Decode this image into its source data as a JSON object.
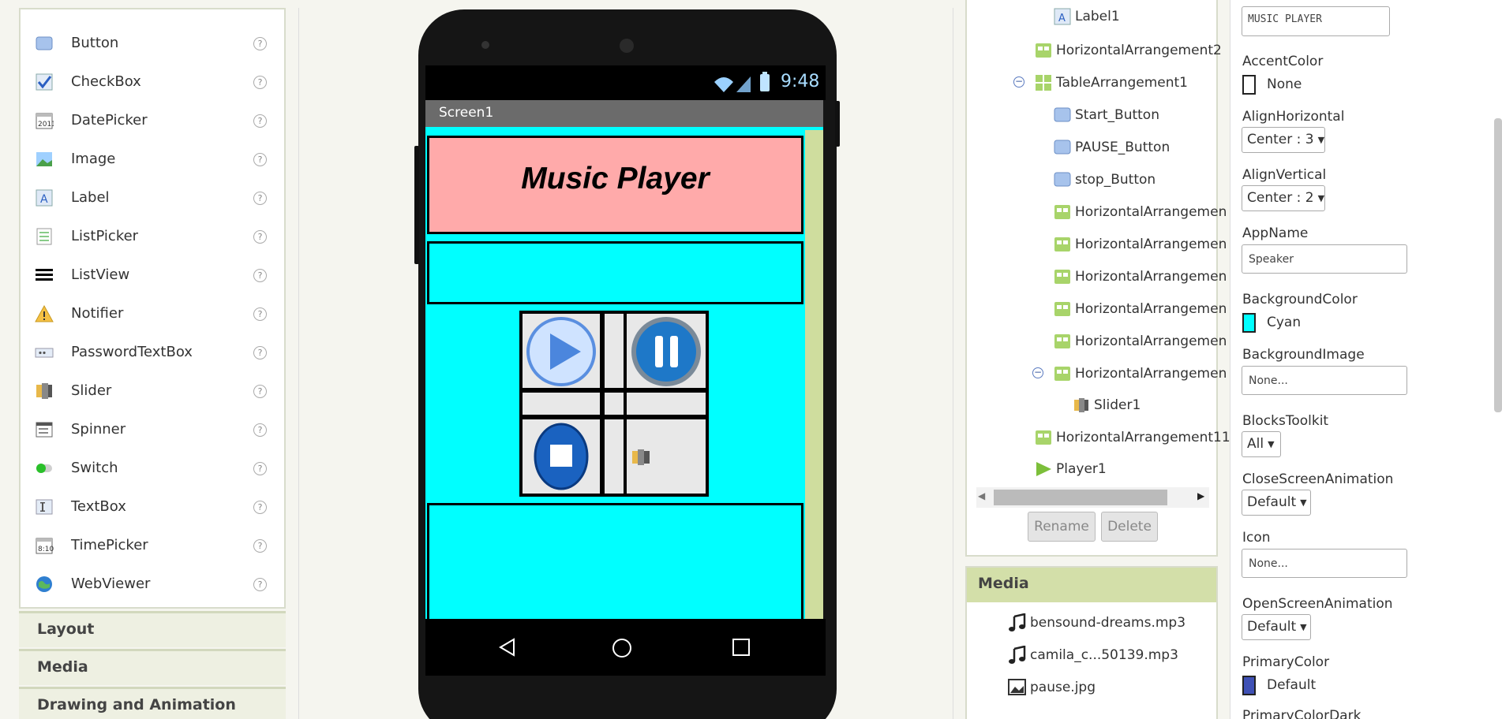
{
  "palette": {
    "items": [
      {
        "label": "Button",
        "icon": "button-icon"
      },
      {
        "label": "CheckBox",
        "icon": "checkbox-icon"
      },
      {
        "label": "DatePicker",
        "icon": "datepicker-icon"
      },
      {
        "label": "Image",
        "icon": "image-icon"
      },
      {
        "label": "Label",
        "icon": "label-icon"
      },
      {
        "label": "ListPicker",
        "icon": "listpicker-icon"
      },
      {
        "label": "ListView",
        "icon": "listview-icon"
      },
      {
        "label": "Notifier",
        "icon": "notifier-icon"
      },
      {
        "label": "PasswordTextBox",
        "icon": "passwordtextbox-icon"
      },
      {
        "label": "Slider",
        "icon": "slider-icon"
      },
      {
        "label": "Spinner",
        "icon": "spinner-icon"
      },
      {
        "label": "Switch",
        "icon": "switch-icon"
      },
      {
        "label": "TextBox",
        "icon": "textbox-icon"
      },
      {
        "label": "TimePicker",
        "icon": "timepicker-icon"
      },
      {
        "label": "WebViewer",
        "icon": "webviewer-icon"
      }
    ],
    "help_glyph": "?",
    "categories": [
      "Layout",
      "Media",
      "Drawing and Animation"
    ]
  },
  "viewer": {
    "status_time": "9:48",
    "screen_title": "Screen1",
    "app_title": "Music Player"
  },
  "components": {
    "tree": [
      "Label1",
      "HorizontalArrangement2",
      "TableArrangement1",
      "Start_Button",
      "PAUSE_Button",
      "stop_Button",
      "HorizontalArrangemen",
      "HorizontalArrangemen",
      "HorizontalArrangemen",
      "HorizontalArrangemen",
      "HorizontalArrangemen",
      "HorizontalArrangemen",
      "Slider1",
      "HorizontalArrangement11",
      "Player1"
    ],
    "collapse_glyph": "−",
    "rename_label": "Rename",
    "delete_label": "Delete"
  },
  "media": {
    "header": "Media",
    "files": [
      "bensound-dreams.mp3",
      "camila_c...50139.mp3",
      "pause.jpg"
    ]
  },
  "properties": {
    "title_value": "MUSIC PLAYER",
    "accent_color": {
      "label": "AccentColor",
      "value": "None"
    },
    "align_horizontal": {
      "label": "AlignHorizontal",
      "value": "Center : 3"
    },
    "align_vertical": {
      "label": "AlignVertical",
      "value": "Center : 2"
    },
    "app_name": {
      "label": "AppName",
      "value": "Speaker"
    },
    "background_color": {
      "label": "BackgroundColor",
      "value": "Cyan",
      "hex": "#00ffff"
    },
    "background_image": {
      "label": "BackgroundImage",
      "value": "None..."
    },
    "blocks_toolkit": {
      "label": "BlocksToolkit",
      "value": "All"
    },
    "close_anim": {
      "label": "CloseScreenAnimation",
      "value": "Default"
    },
    "icon": {
      "label": "Icon",
      "value": "None..."
    },
    "open_anim": {
      "label": "OpenScreenAnimation",
      "value": "Default"
    },
    "primary_color": {
      "label": "PrimaryColor",
      "value": "Default",
      "hex": "#3f51b5"
    },
    "primary_color_dark": {
      "label": "PrimaryColorDark"
    }
  }
}
